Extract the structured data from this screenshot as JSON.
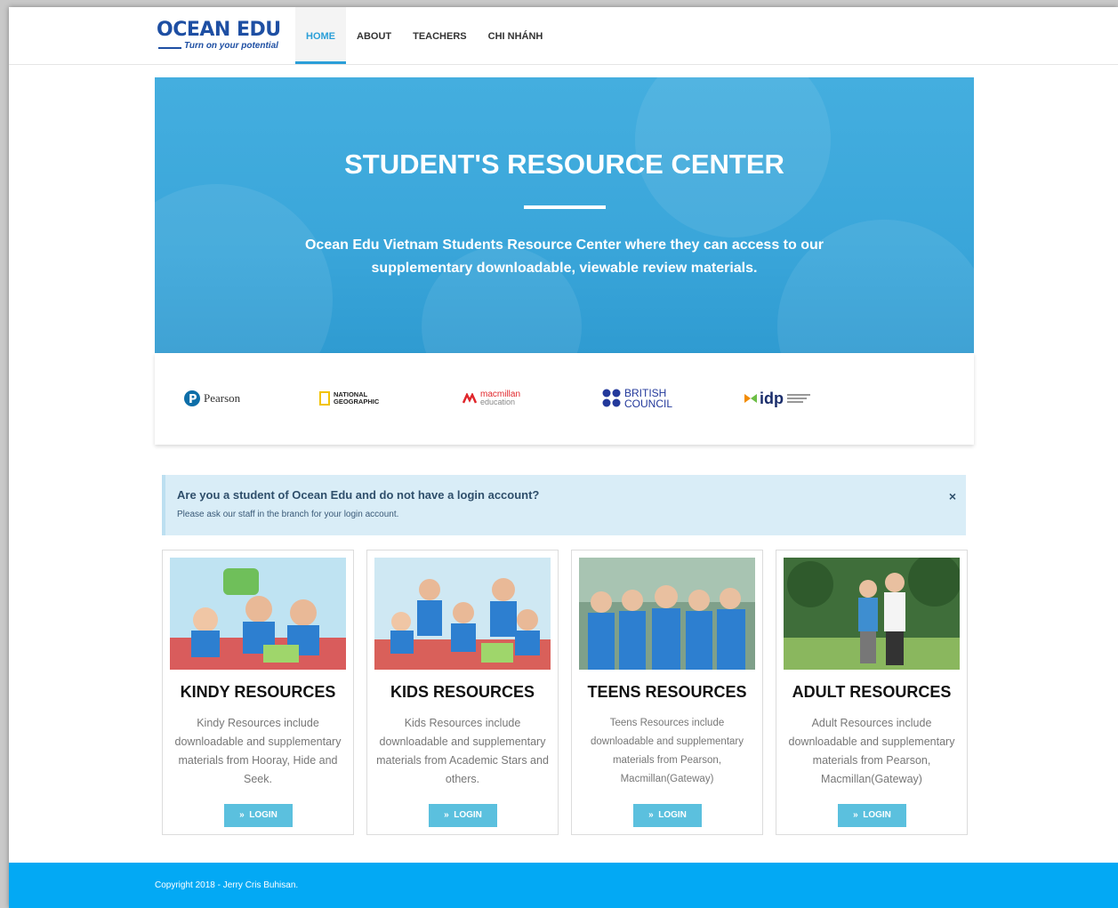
{
  "logo": {
    "main": "OCEAN EDU",
    "tagline": "Turn on your potential"
  },
  "nav": [
    {
      "label": "HOME",
      "active": true
    },
    {
      "label": "ABOUT",
      "active": false
    },
    {
      "label": "TEACHERS",
      "active": false
    },
    {
      "label": "CHI NHÁNH",
      "active": false
    }
  ],
  "hero": {
    "title": "STUDENT'S RESOURCE CENTER",
    "text": "Ocean Edu Vietnam Students Resource Center where they can access to our supplementary downloadable, viewable review materials."
  },
  "partners": {
    "pearson": "Pearson",
    "natgeo": "NATIONAL GEOGRAPHIC",
    "macmillan_1": "macmillan",
    "macmillan_2": "education",
    "british_1": "BRITISH",
    "british_2": "COUNCIL",
    "idp": "idp"
  },
  "alert": {
    "title": "Are you a student of Ocean Edu and do not have a login account?",
    "message": "Please ask our staff in the branch for your login account.",
    "close": "×"
  },
  "cards": [
    {
      "title": "KINDY RESOURCES",
      "desc": "Kindy Resources include downloadable and supplementary materials from Hooray, Hide and Seek.",
      "button": "LOGIN"
    },
    {
      "title": "KIDS RESOURCES",
      "desc": "Kids Resources include downloadable and supplementary materials from Academic Stars and others.",
      "button": "LOGIN"
    },
    {
      "title": "TEENS RESOURCES",
      "desc": "Teens Resources include downloadable and supplementary materials from Pearson, Macmillan(Gateway)",
      "button": "LOGIN"
    },
    {
      "title": "ADULT RESOURCES",
      "desc": "Adult Resources include downloadable and supplementary materials from Pearson, Macmillan(Gateway)",
      "button": "LOGIN"
    }
  ],
  "button_icon": "»",
  "footer": {
    "copyright": "Copyright 2018 - Jerry Cris Buhisan."
  },
  "colors": {
    "accent": "#2b9fd8",
    "hero": "#3aa6da",
    "footer": "#03a9f4",
    "button": "#5bc0de",
    "alert": "#d9edf7"
  }
}
